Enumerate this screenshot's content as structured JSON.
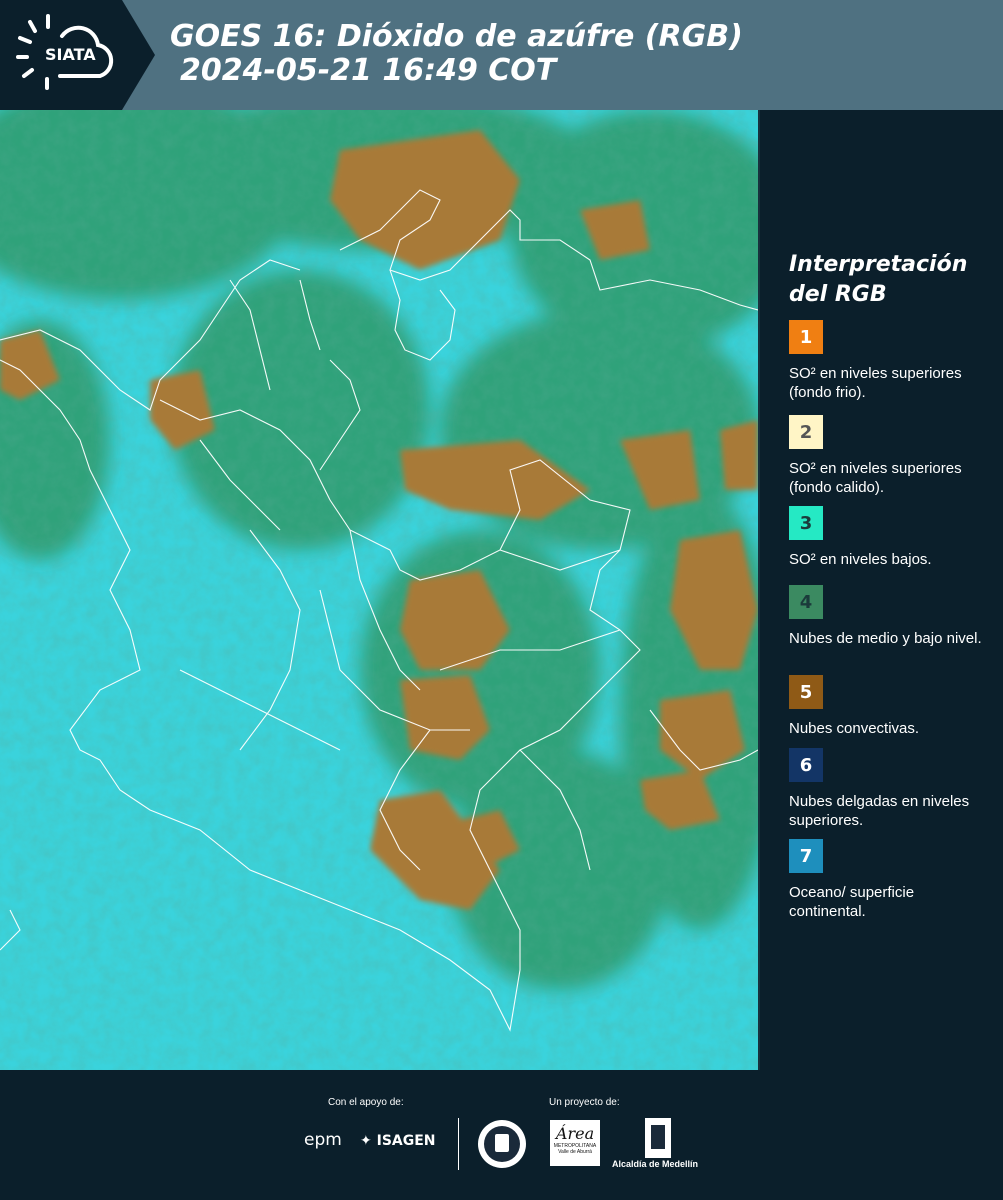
{
  "header": {
    "logo_text": "SIATA",
    "title": "GOES 16: Dióxido de azúfre (RGB)",
    "subtitle": "2024-05-21 16:49 COT"
  },
  "legend": {
    "title_line1": "Interpretación",
    "title_line2": "del RGB",
    "items": [
      {
        "number": "1",
        "label": "SO² en niveles superiores (fondo frio).",
        "color": "#f07f12"
      },
      {
        "number": "2",
        "label": "SO² en niveles superiores (fondo calido).",
        "color": "#fff5c6"
      },
      {
        "number": "3",
        "label": "SO² en niveles bajos.",
        "color": "#25e9c4"
      },
      {
        "number": "4",
        "label": "Nubes de medio y bajo nivel.",
        "color": "#3b8a61"
      },
      {
        "number": "5",
        "label": "Nubes convectivas.",
        "color": "#8f5a16"
      },
      {
        "number": "6",
        "label": "Nubes delgadas en niveles superiores.",
        "color": "#133566"
      },
      {
        "number": "7",
        "label": "Oceano/ superficie continental.",
        "color": "#1e8fbd"
      }
    ]
  },
  "footer": {
    "support_caption": "Con el apoyo de:",
    "project_caption": "Un proyecto de:",
    "epm": "epm",
    "isagen": "ISAGEN",
    "area_logo": "Área",
    "area_sub": "METROPOLITANA",
    "area_sub2": "Valle de Aburrá",
    "alcaldia": "Alcaldía de Medellín"
  },
  "colors": {
    "background": "#0b1f2b",
    "header": "#4f7181",
    "ocean": "#3ad3dc",
    "convective": "#a87a38",
    "vegetation": "#2f8a55"
  }
}
